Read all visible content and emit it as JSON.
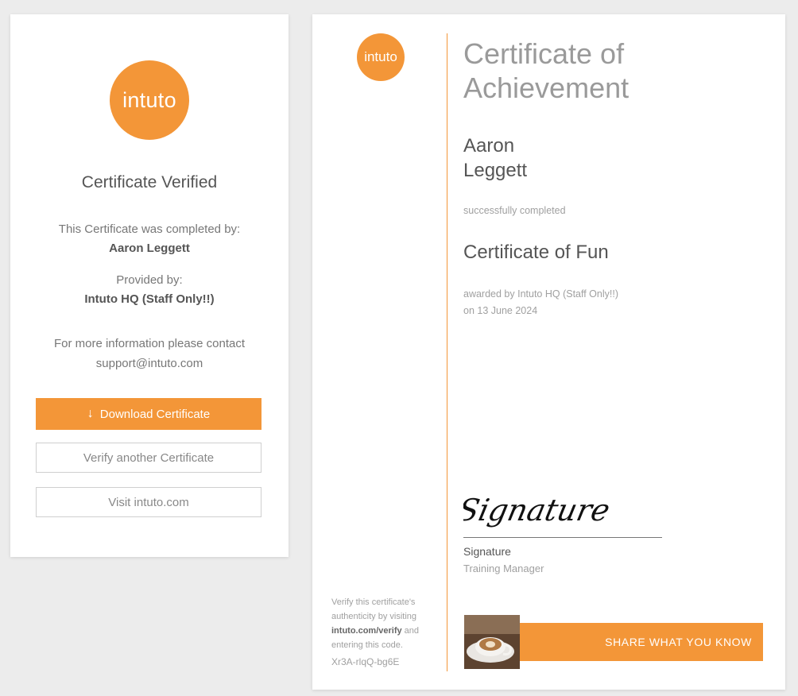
{
  "verify_card": {
    "logo_text": "intuto",
    "title": "Certificate Verified",
    "completed_by_label": "This Certificate was completed by:",
    "completed_by_name": "Aaron Leggett",
    "provided_by_label": "Provided by:",
    "provided_by_name": "Intuto HQ (Staff Only!!)",
    "contact_label": "For more information please contact",
    "contact_email": "support@intuto.com",
    "download_label": "Download Certificate",
    "verify_another_label": "Verify another Certificate",
    "visit_label": "Visit intuto.com"
  },
  "certificate": {
    "logo_text": "intuto",
    "title_line1": "Certificate of",
    "title_line2": "Achievement",
    "first_name": "Aaron",
    "last_name": "Leggett",
    "completed_text": "successfully completed",
    "course_name": "Certificate of Fun",
    "awarded_by": "awarded by Intuto HQ (Staff Only!!)",
    "awarded_date": "on 13 June 2024",
    "signature_script": "Signature",
    "signature_name": "Signature",
    "signature_role": "Training Manager",
    "verify_text_1": "Verify this certificate's authenticity by visiting ",
    "verify_link": "intuto.com/verify",
    "verify_text_2": " and entering this code.",
    "verify_code": "Xr3A-rlqQ-bg6E",
    "banner_text": "SHARE WHAT YOU KNOW"
  },
  "colors": {
    "accent": "#f39638",
    "text": "#555555",
    "muted": "#a0a0a0"
  }
}
